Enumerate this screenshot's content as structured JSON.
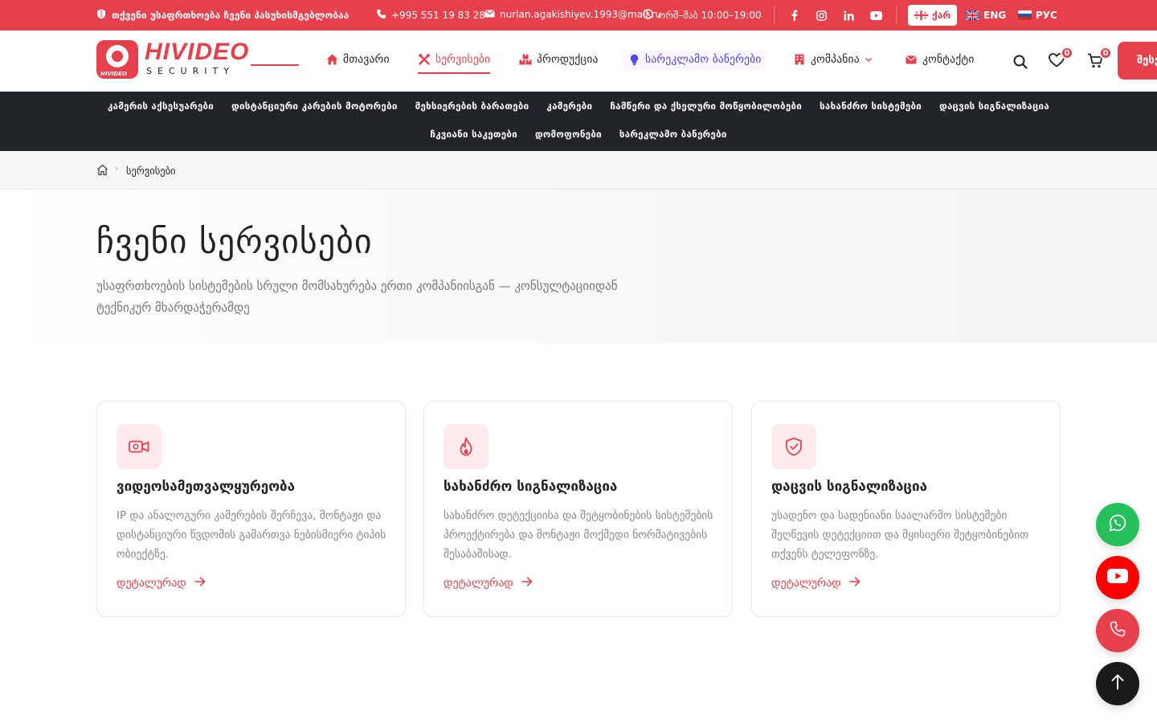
{
  "topbar": {
    "slogan": "თქვენი უსაფრთხოება ჩვენი პასუხისმგებლობაა",
    "phone": "+995 551 19 83 28",
    "email": "nurlan.agakishiyev.1993@mail.ru",
    "hours": "ორშ–შაბ 10:00–19:00",
    "social": [
      "facebook-icon",
      "instagram-icon",
      "linkedin-icon",
      "youtube-icon"
    ],
    "languages": [
      {
        "label": "ქარ",
        "active": true
      },
      {
        "label": "ENG",
        "active": false
      },
      {
        "label": "РУС",
        "active": false
      }
    ]
  },
  "header": {
    "logo_word": "HIVIDEO",
    "logo_sub": "SECURITY",
    "logo_badge": "HIVIDEO",
    "nav": [
      {
        "label": "მთავარი",
        "icon": "home-icon"
      },
      {
        "label": "სერვისები",
        "icon": "tools-icon",
        "active": true
      },
      {
        "label": "პროდუქცია",
        "icon": "boxes-icon"
      },
      {
        "label": "სარეკლამო ბანერები",
        "icon": "lightbulb-icon"
      },
      {
        "label": "კომპანია",
        "icon": "building-icon"
      },
      {
        "label": "კონტაქტი",
        "icon": "envelope-icon"
      }
    ],
    "wishlist_count": "0",
    "cart_count": "0",
    "login_label": "შესვლა"
  },
  "categories": {
    "row1": [
      "კამერის აქსესუარები",
      "დისტანციური კარების მოტორები",
      "მეხსიერების ბარათები",
      "კამერები",
      "ჩამწერი და ქსელური მოწყობილობები",
      "სახანძრო სისტემები",
      "დაცვის სიგნალიზაცია"
    ],
    "row2": [
      "ჩკვიანი საკეთები",
      "დომოფონები",
      "სარეკლამო ბანერები"
    ]
  },
  "breadcrumb": {
    "current": "სერვისები"
  },
  "hero": {
    "title": "ჩვენი სერვისები",
    "subtitle": "უსაფრთხოების სისტემების სრული მომსახურება ერთი კომპანიისგან — კონსულტაციიდან ტექნიკურ მხარდაჭერამდე"
  },
  "services": [
    {
      "icon": "video-camera-icon",
      "title": "ვიდეოსამეთვალყურეობა",
      "description": "IP და ანალოგური კამერების შერჩევა, მონტაჟი და დისტანციური წვდომის გამართვა ნებისმიერი ტიპის ობიექტზე.",
      "link": "დეტალურად"
    },
    {
      "icon": "flame-icon",
      "title": "სახანძრო სიგნალიზაცია",
      "description": "სახანძრო დეტექციისა და შეტყობინების სისტემების პროექტირება და მონტაჟი მოქმედი ნორმატივების შესაბამისად.",
      "link": "დეტალურად"
    },
    {
      "icon": "shield-check-icon",
      "title": "დაცვის სიგნალიზაცია",
      "description": "უსადენო და სადენიანი საალარმო სისტემები შეღწევის დეტექციით და მყისიერი შეტყობინებით თქვენს ტელეფონზე.",
      "link": "დეტალურად"
    }
  ],
  "colors": {
    "brand": "#e5404b",
    "dark": "#212529",
    "whatsapp": "#25c05b",
    "youtube": "#ff0000"
  }
}
